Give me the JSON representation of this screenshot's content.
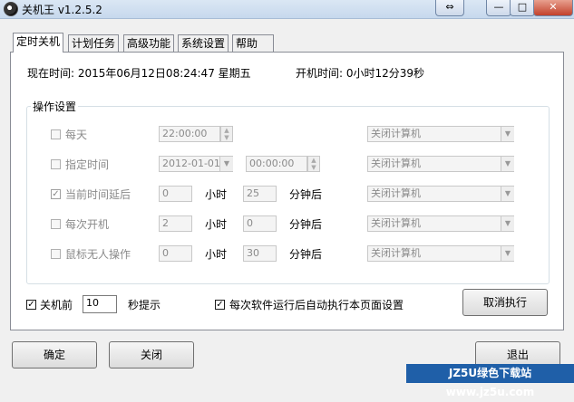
{
  "window": {
    "title": "关机王 v1.2.5.2"
  },
  "tabs": [
    {
      "label": "定时关机"
    },
    {
      "label": "计划任务"
    },
    {
      "label": "高级功能"
    },
    {
      "label": "系统设置"
    },
    {
      "label": "帮助"
    }
  ],
  "status": {
    "current_time": "现在时间: 2015年06月12日08:24:47 星期五",
    "uptime": "开机时间: 0小时12分39秒"
  },
  "ops": {
    "title": "操作设置",
    "rows": [
      {
        "label": "每天",
        "checked": false,
        "value": "22:00:00",
        "action": "关闭计算机"
      },
      {
        "label": "指定时间",
        "checked": false,
        "date": "2012-01-01",
        "time": "00:00:00",
        "action": "关闭计算机"
      },
      {
        "label": "当前时间延后",
        "checked": true,
        "hours": "0",
        "hour_unit": "小时",
        "minutes": "25",
        "minute_unit": "分钟后",
        "action": "关闭计算机"
      },
      {
        "label": "每次开机",
        "checked": false,
        "hours": "2",
        "hour_unit": "小时",
        "minutes": "0",
        "minute_unit": "分钟后",
        "action": "关闭计算机"
      },
      {
        "label": "鼠标无人操作",
        "checked": false,
        "hours": "0",
        "hour_unit": "小时",
        "minutes": "30",
        "minute_unit": "分钟后",
        "action": "关闭计算机"
      }
    ]
  },
  "bottom": {
    "shutdown_before_label": "关机前",
    "shutdown_before_checked": true,
    "shutdown_before_value": "10",
    "seconds_prompt": "秒提示",
    "auto_run_label": "每次软件运行后自动执行本页面设置",
    "auto_run_checked": true,
    "cancel_exec": "取消执行"
  },
  "footer": {
    "ok": "确定",
    "close": "关闭",
    "exit": "退出"
  },
  "watermark": "JZ5U绿色下载站www.jz5u.com"
}
